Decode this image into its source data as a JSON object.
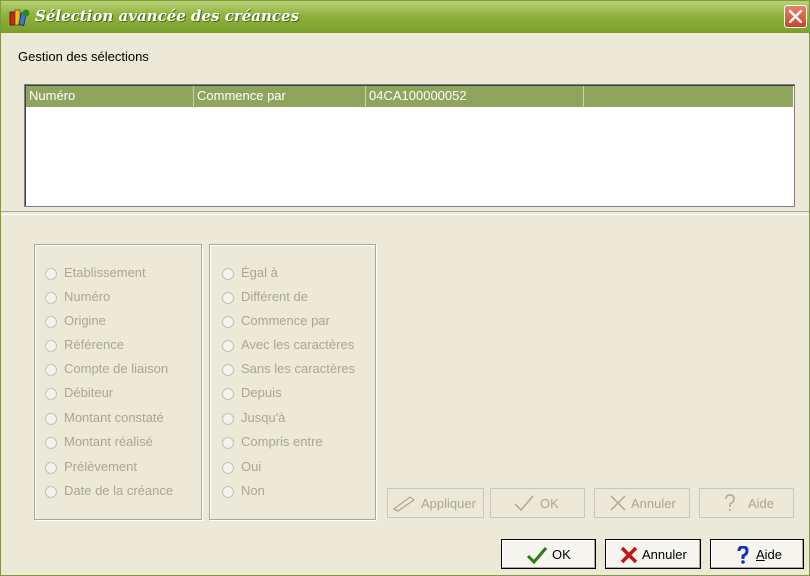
{
  "window": {
    "title": "Sélection avancée des créances"
  },
  "menu": {
    "label": "Gestion des sélections"
  },
  "list": {
    "row": {
      "field": "Numéro",
      "operator": "Commence par",
      "value": "04CA100000052"
    }
  },
  "fields": {
    "options": [
      "Etablissement",
      "Numéro",
      "Origine",
      "Référence",
      "Compte de liaison",
      "Débiteur",
      "Montant constaté",
      "Montant réalisé",
      "Prélèvement",
      "Date de la créance"
    ]
  },
  "operators": {
    "options": [
      "Égal à",
      "Différent de",
      "Commence par",
      "Avec les caractères",
      "Sans les caractères",
      "Depuis",
      "Jusqu'à",
      "Compris entre",
      "Oui",
      "Non"
    ]
  },
  "inner_buttons": {
    "apply": "Appliquer",
    "ok": "OK",
    "cancel": "Annuler",
    "help": "Aide"
  },
  "footer_buttons": {
    "ok": "OK",
    "cancel": "Annuler",
    "help_accel": "A",
    "help_rest": "ide"
  },
  "icons": {
    "title": "app-books-icon",
    "close": "close-x-icon",
    "apply": "pencil-icon",
    "ok": "checkmark-icon",
    "cancel": "x-icon",
    "help": "question-mark-icon"
  },
  "colors": {
    "title_bar": "#8fb23e",
    "selected_row": "#8fa45c",
    "close": "#c9432a",
    "ok_check": "#2d7a1a",
    "cancel_x": "#c81010",
    "help_q": "#1030c0"
  }
}
